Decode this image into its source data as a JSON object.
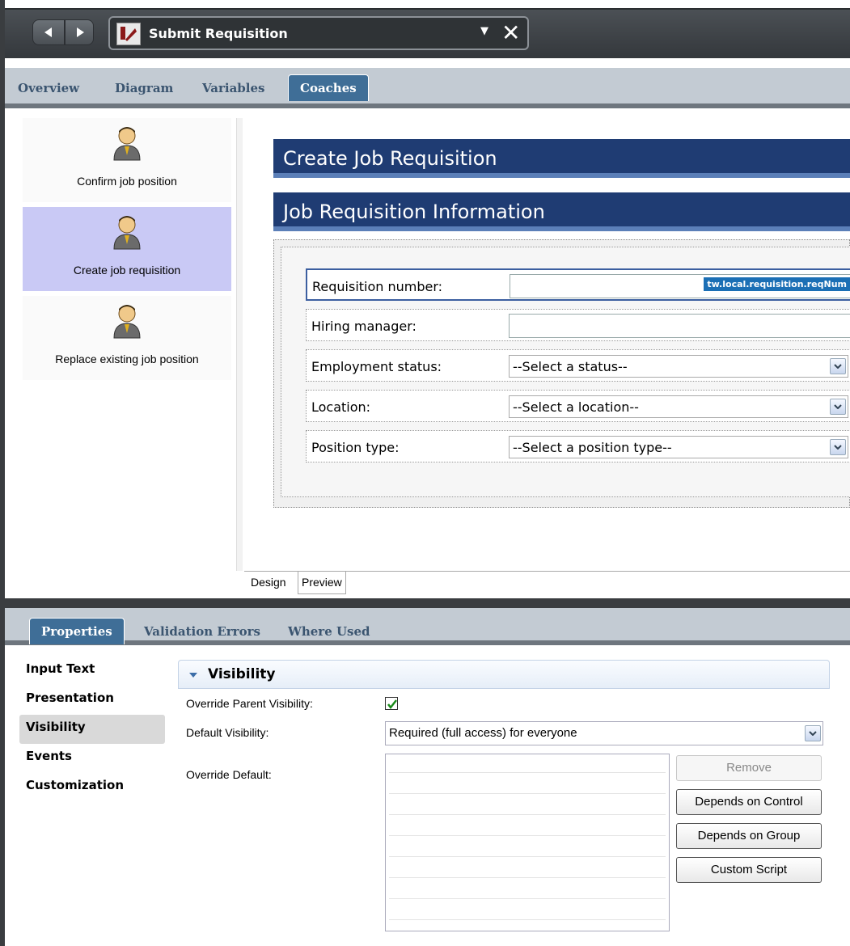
{
  "window": {
    "doc_title": "Submit Requisition",
    "tabs": [
      "Overview",
      "Diagram",
      "Variables",
      "Coaches"
    ],
    "active_tab": "Coaches"
  },
  "coaches": [
    {
      "label": "Confirm job position",
      "selected": false
    },
    {
      "label": "Create job requisition",
      "selected": true
    },
    {
      "label": "Replace existing job position",
      "selected": false
    }
  ],
  "canvas": {
    "banner_title": "Create Job Requisition",
    "section_title": "Job Requisition Information",
    "rows": [
      {
        "label": "Requisition number:",
        "type": "text",
        "value": "",
        "binding": "tw.local.requisition.reqNum"
      },
      {
        "label": "Hiring manager:",
        "type": "text",
        "value": ""
      },
      {
        "label": "Employment status:",
        "type": "select",
        "value": "--Select a status--"
      },
      {
        "label": "Location:",
        "type": "select",
        "value": "--Select a location--"
      },
      {
        "label": "Position type:",
        "type": "select",
        "value": "--Select a position type--"
      }
    ],
    "bottom_tabs": [
      "Design",
      "Preview"
    ],
    "active_bottom_tab": "Design"
  },
  "properties": {
    "tabs": [
      "Properties",
      "Validation Errors",
      "Where Used"
    ],
    "active_tab": "Properties",
    "side_items": [
      "Input Text",
      "Presentation",
      "Visibility",
      "Events",
      "Customization"
    ],
    "active_side": "Visibility",
    "section_title": "Visibility",
    "override_parent_label": "Override Parent Visibility:",
    "override_parent_checked": true,
    "default_visibility_label": "Default Visibility:",
    "default_visibility_value": "Required (full access) for everyone",
    "override_default_label": "Override Default:",
    "buttons": [
      "Remove",
      "Depends on Control",
      "Depends on Group",
      "Custom Script"
    ]
  },
  "colors": {
    "banner": "#1f3c73",
    "accent_tab": "#3f6e97",
    "selected_coach": "#c9c9f5"
  }
}
